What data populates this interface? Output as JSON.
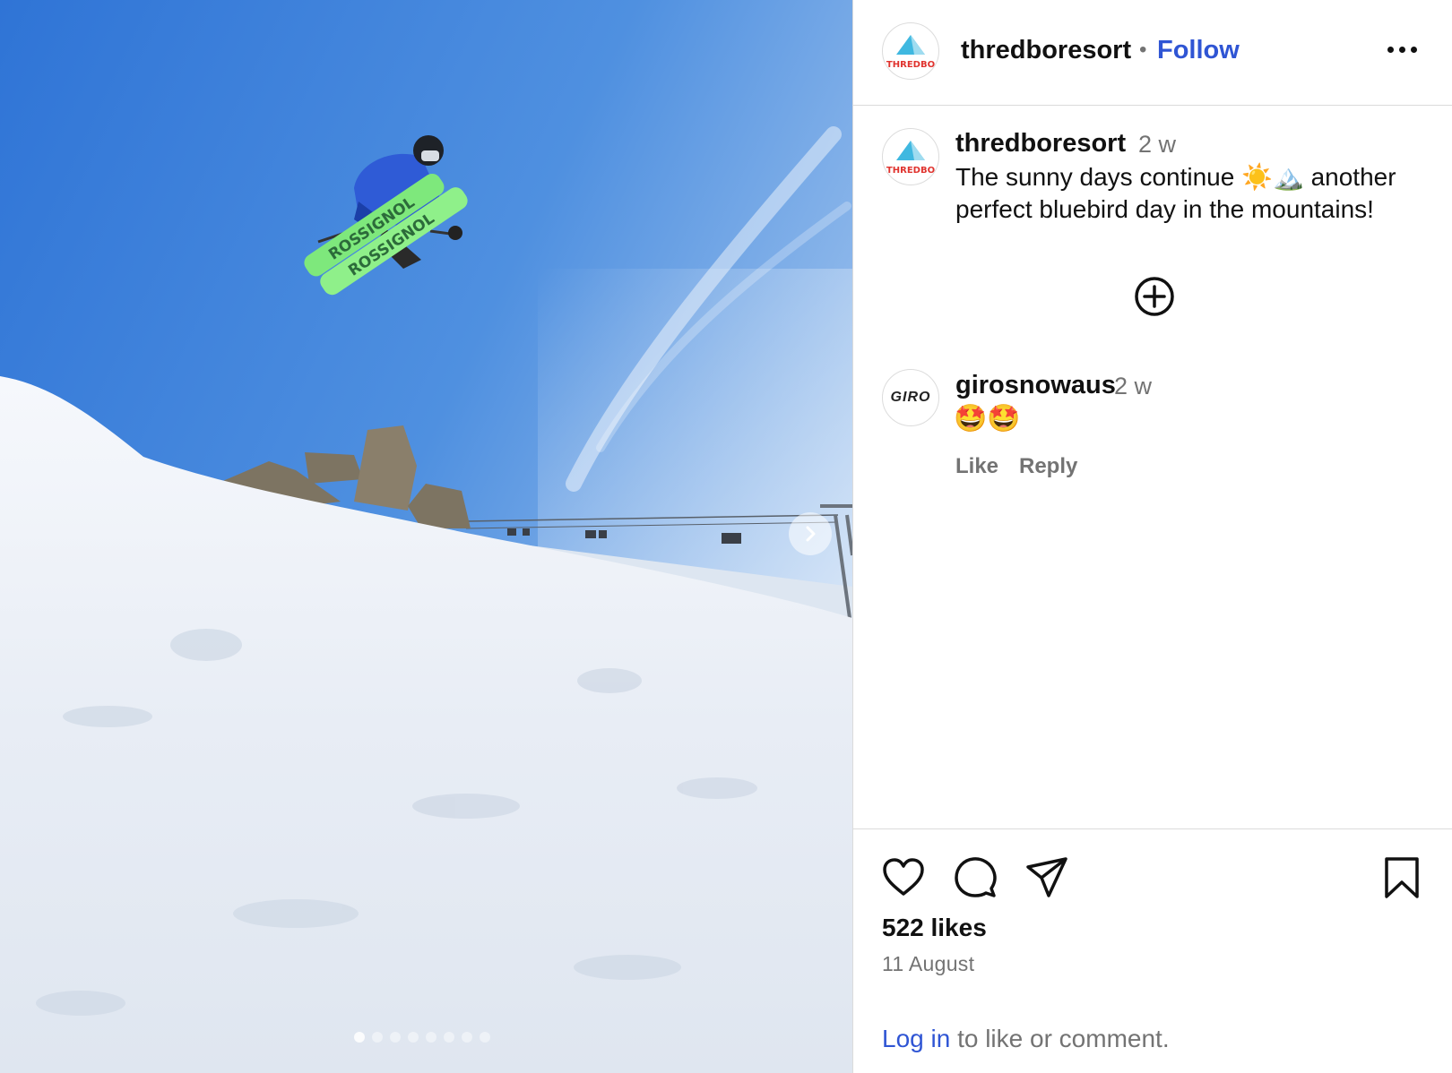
{
  "post": {
    "username": "thredboresort",
    "separator": "•",
    "follow_label": "Follow",
    "logo_text": "THREDBO",
    "colors": {
      "follow_blue": "#2f55d4",
      "sky": "#3d86dc",
      "ski_green": "#7ee87c"
    }
  },
  "media": {
    "ski_brand": "ROSSIGNOL",
    "slide_count": 8,
    "active_slide": 1
  },
  "caption": {
    "username": "thredboresort",
    "time": "2 w",
    "text": "The sunny days continue ☀️🏔️ another perfect bluebird day in the mountains!"
  },
  "comments": [
    {
      "username": "girosnowaus",
      "avatar_text": "GIRO",
      "time": "2 w",
      "text": "🤩🤩",
      "like_label": "Like",
      "reply_label": "Reply"
    }
  ],
  "actions": {
    "icons": [
      "heart-icon",
      "comment-icon",
      "share-icon",
      "bookmark-icon"
    ],
    "likes": "522 likes",
    "date": "11 August",
    "login_link": "Log in",
    "login_suffix": " to like or comment."
  }
}
